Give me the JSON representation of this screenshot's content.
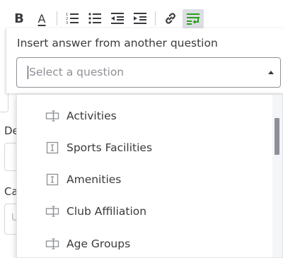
{
  "toolbar": {
    "bold_label": "B",
    "font_color_label": "A"
  },
  "popover": {
    "title": "Insert answer from another question",
    "select_placeholder": "Select a question"
  },
  "background": {
    "label_1": "De",
    "label_2": "Ca",
    "link_fragment": "C",
    "input_fragment_1": "I",
    "input_fragment_2": "U"
  },
  "dropdown": {
    "options": [
      {
        "label": "Activities",
        "icon": "dropdown-choice-icon"
      },
      {
        "label": "Sports Facilities",
        "icon": "text-field-icon"
      },
      {
        "label": "Amenities",
        "icon": "text-field-icon"
      },
      {
        "label": "Club Affiliation",
        "icon": "dropdown-choice-icon"
      },
      {
        "label": "Age Groups",
        "icon": "dropdown-choice-icon"
      }
    ]
  },
  "colors": {
    "text": "#393a3d",
    "placeholder": "#8d9096",
    "active_tool_bg": "#dcdee3",
    "active_tool_icon": "#2ca01c",
    "link_color": "#0077c5"
  }
}
